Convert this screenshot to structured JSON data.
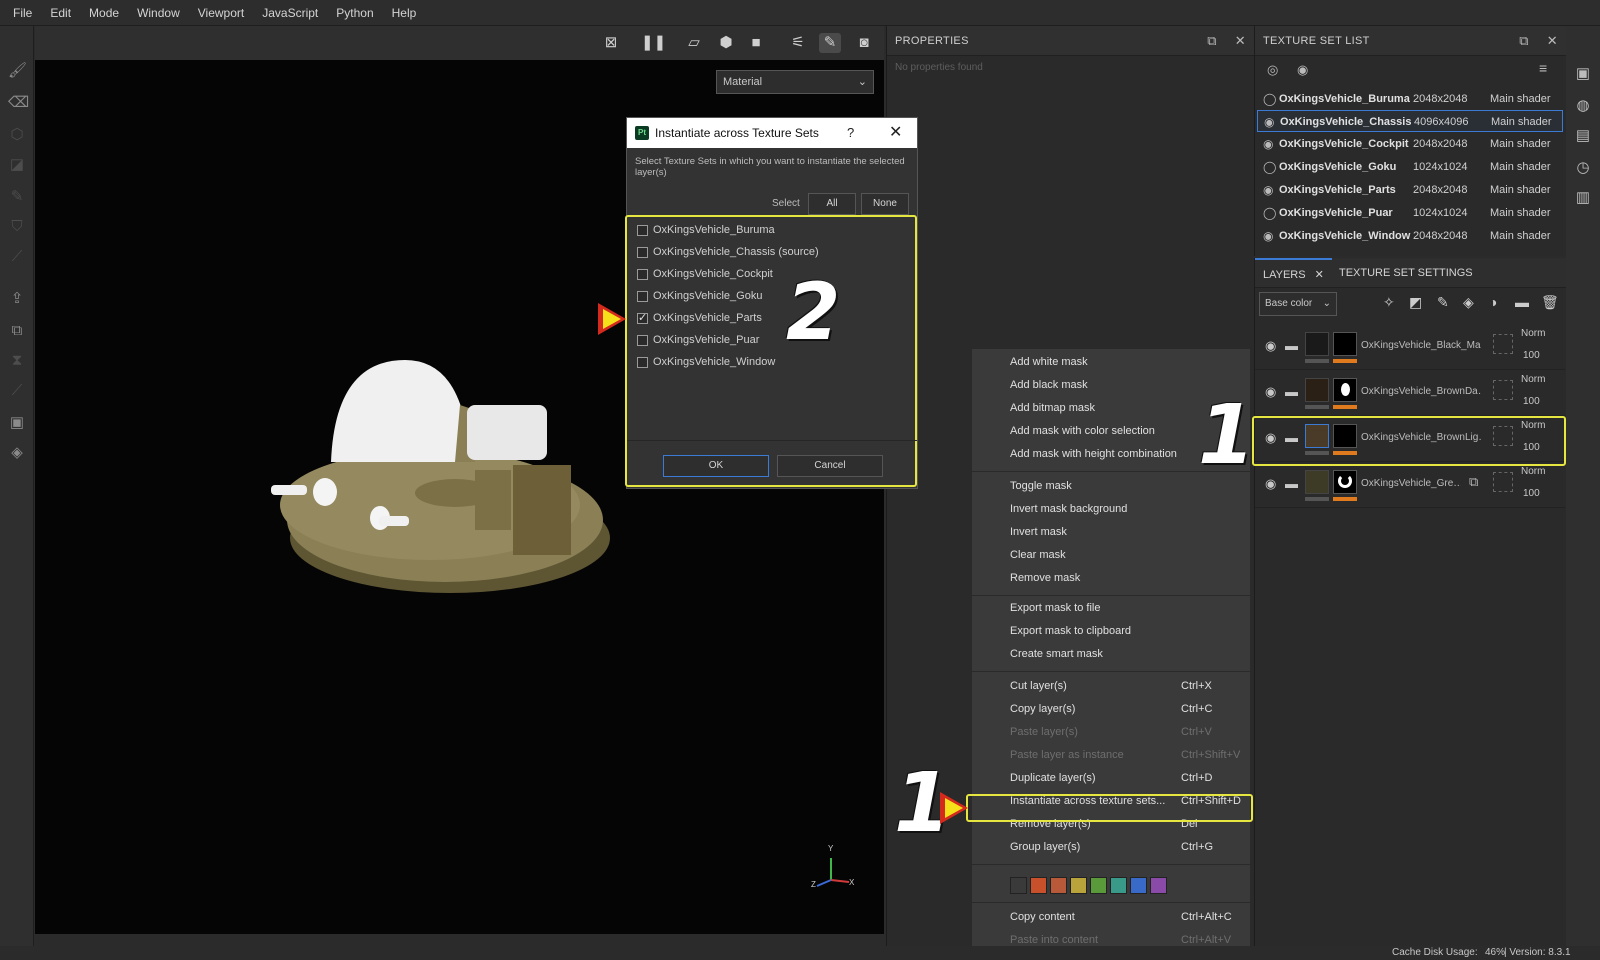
{
  "menubar": [
    "File",
    "Edit",
    "Mode",
    "Window",
    "Viewport",
    "JavaScript",
    "Python",
    "Help"
  ],
  "viewport": {
    "material_select": "Material",
    "axes": [
      "Z",
      "Y",
      "X"
    ]
  },
  "properties": {
    "title": "PROPERTIES",
    "empty": "No properties found"
  },
  "texture_set_list": {
    "title": "TEXTURE SET LIST",
    "rows": [
      {
        "name": "OxKingsVehicle_Buruma",
        "res": "2048x2048",
        "shader": "Main shader"
      },
      {
        "name": "OxKingsVehicle_Chassis",
        "res": "4096x4096",
        "shader": "Main shader"
      },
      {
        "name": "OxKingsVehicle_Cockpit",
        "res": "2048x2048",
        "shader": "Main shader"
      },
      {
        "name": "OxKingsVehicle_Goku",
        "res": "1024x1024",
        "shader": "Main shader"
      },
      {
        "name": "OxKingsVehicle_Parts",
        "res": "2048x2048",
        "shader": "Main shader"
      },
      {
        "name": "OxKingsVehicle_Puar",
        "res": "1024x1024",
        "shader": "Main shader"
      },
      {
        "name": "OxKingsVehicle_Window",
        "res": "2048x2048",
        "shader": "Main shader"
      }
    ]
  },
  "layers": {
    "tab_layers": "LAYERS",
    "tab_settings": "TEXTURE SET SETTINGS",
    "channel_select": "Base color",
    "items": [
      {
        "name": "OxKingsVehicle_Black_Ma…",
        "blend": "Norm",
        "opacity": "100"
      },
      {
        "name": "OxKingsVehicle_BrownDa…",
        "blend": "Norm",
        "opacity": "100"
      },
      {
        "name": "OxKingsVehicle_BrownLig…",
        "blend": "Norm",
        "opacity": "100"
      },
      {
        "name": "OxKingsVehicle_Gre…",
        "blend": "Norm",
        "opacity": "100"
      }
    ]
  },
  "dialog": {
    "title": "Instantiate across Texture Sets",
    "help": "?",
    "close": "✕",
    "description": "Select Texture Sets in which you want to instantiate the selected layer(s)",
    "select_label": "Select",
    "all": "All",
    "none": "None",
    "options": [
      {
        "label": "OxKingsVehicle_Buruma",
        "checked": false
      },
      {
        "label": "OxKingsVehicle_Chassis (source)",
        "checked": false
      },
      {
        "label": "OxKingsVehicle_Cockpit",
        "checked": false
      },
      {
        "label": "OxKingsVehicle_Goku",
        "checked": false
      },
      {
        "label": "OxKingsVehicle_Parts",
        "checked": true
      },
      {
        "label": "OxKingsVehicle_Puar",
        "checked": false
      },
      {
        "label": "OxKingsVehicle_Window",
        "checked": false
      }
    ],
    "ok": "OK",
    "cancel": "Cancel"
  },
  "context_menu": {
    "items": [
      {
        "label": "Add white mask",
        "shortcut": "",
        "disabled": false
      },
      {
        "label": "Add black mask",
        "shortcut": "",
        "disabled": false
      },
      {
        "label": "Add bitmap mask",
        "shortcut": "",
        "disabled": false
      },
      {
        "label": "Add mask with color selection",
        "shortcut": "",
        "disabled": false
      },
      {
        "label": "Add mask with height combination",
        "shortcut": "",
        "disabled": false
      },
      {
        "label": "Toggle mask",
        "shortcut": "",
        "disabled": false
      },
      {
        "label": "Invert mask background",
        "shortcut": "",
        "disabled": false
      },
      {
        "label": "Invert mask",
        "shortcut": "",
        "disabled": false
      },
      {
        "label": "Clear mask",
        "shortcut": "",
        "disabled": false
      },
      {
        "label": "Remove mask",
        "shortcut": "",
        "disabled": false
      },
      {
        "label": "Export mask to file",
        "shortcut": "",
        "disabled": false
      },
      {
        "label": "Export mask to clipboard",
        "shortcut": "",
        "disabled": false
      },
      {
        "label": "Create smart mask",
        "shortcut": "",
        "disabled": false
      },
      {
        "label": "Cut layer(s)",
        "shortcut": "Ctrl+X",
        "disabled": false
      },
      {
        "label": "Copy layer(s)",
        "shortcut": "Ctrl+C",
        "disabled": false
      },
      {
        "label": "Paste layer(s)",
        "shortcut": "Ctrl+V",
        "disabled": true
      },
      {
        "label": "Paste layer as instance",
        "shortcut": "Ctrl+Shift+V",
        "disabled": true
      },
      {
        "label": "Duplicate layer(s)",
        "shortcut": "Ctrl+D",
        "disabled": false
      },
      {
        "label": "Instantiate across texture sets...",
        "shortcut": "Ctrl+Shift+D",
        "disabled": false
      },
      {
        "label": "Remove layer(s)",
        "shortcut": "Del",
        "disabled": false
      },
      {
        "label": "Group layer(s)",
        "shortcut": "Ctrl+G",
        "disabled": false
      },
      {
        "label": "Copy content",
        "shortcut": "Ctrl+Alt+C",
        "disabled": false
      },
      {
        "label": "Paste into content",
        "shortcut": "Ctrl+Alt+V",
        "disabled": true
      }
    ],
    "swatches": [
      "#3a3a3a",
      "#c8502a",
      "#b85a3a",
      "#b8a43a",
      "#5a9a3a",
      "#3a9a8a",
      "#3a6ac8",
      "#8a4aa8"
    ]
  },
  "status": {
    "cache_label": "Cache Disk Usage:",
    "cache_value": "46%",
    "version": "| Version: 8.3.1"
  },
  "annotations": {
    "one": "1",
    "two": "2"
  }
}
